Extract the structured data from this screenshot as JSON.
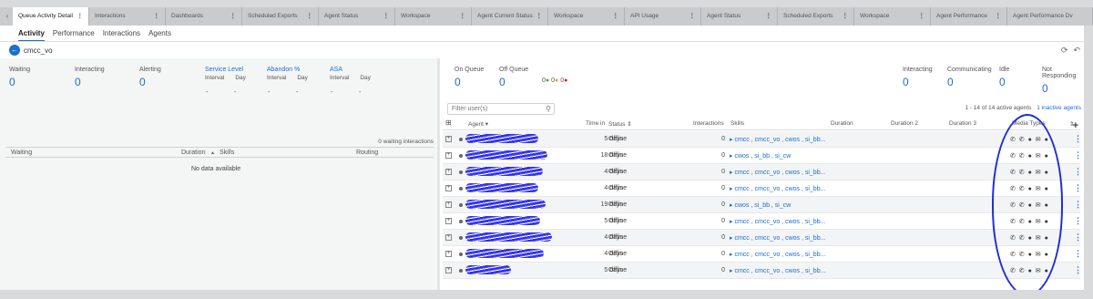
{
  "tabs": [
    {
      "label": "Queue Activity Detail",
      "active": true
    },
    {
      "label": "Interactions"
    },
    {
      "label": "Dashboards"
    },
    {
      "label": "Scheduled Exports"
    },
    {
      "label": "Agent Status"
    },
    {
      "label": "Workspace"
    },
    {
      "label": "Agent Current Status"
    },
    {
      "label": "Workspace"
    },
    {
      "label": "API Usage"
    },
    {
      "label": "Agent Status"
    },
    {
      "label": "Scheduled Exports"
    },
    {
      "label": "Workspace"
    },
    {
      "label": "Agent Performance"
    },
    {
      "label": "Agent Performance Dv"
    }
  ],
  "subtabs": [
    "Activity",
    "Performance",
    "Interactions",
    "Agents"
  ],
  "queue_name": "cmcc_vo",
  "left_stats": {
    "waiting": {
      "label": "Waiting",
      "value": "0"
    },
    "interacting": {
      "label": "Interacting",
      "value": "0"
    },
    "alerting": {
      "label": "Alerting",
      "value": "0"
    },
    "service_level": {
      "label": "Service Level",
      "interval": "Interval",
      "day": "Day",
      "dash": "-"
    },
    "abandon": {
      "label": "Abandon %",
      "interval": "Interval",
      "day": "Day",
      "dash": "-"
    },
    "asa": {
      "label": "ASA",
      "interval": "Interval",
      "day": "Day",
      "dash": "-"
    }
  },
  "waiting_interactions": "0 waiting interactions",
  "left_table": {
    "waiting": "Waiting",
    "duration": "Duration",
    "sort": "▲",
    "skills": "Skills",
    "routing": "Routing",
    "empty": "No data available"
  },
  "right_stats": {
    "on_queue": {
      "label": "On Queue",
      "value": "0"
    },
    "off_queue": {
      "label": "Off Queue",
      "value": "0"
    },
    "dots": [
      "0",
      "0",
      "0"
    ],
    "interacting": {
      "label": "Interacting",
      "value": "0"
    },
    "communicating": {
      "label": "Communicating",
      "value": "0"
    },
    "idle": {
      "label": "Idle",
      "value": "0"
    },
    "not_responding": {
      "label": "Not Responding",
      "value": "0"
    }
  },
  "filter_placeholder": "Filter user(s)",
  "agent_count": "1 - 14 of 14 active agents",
  "inactive_link": "1 inactive agents",
  "columns": {
    "agent": "Agent",
    "time_in": "Time in",
    "status": "Status",
    "interactions": "Interactions",
    "skills": "Skills",
    "duration": "Duration",
    "duration2": "Duration 2",
    "duration3": "Duration 3",
    "media": "Media Types"
  },
  "rows": [
    {
      "time_in": "5 days",
      "status": "Offline",
      "interactions": "0",
      "skills": "▸ cmcc , cmcc_vo , cwos , si_bb..."
    },
    {
      "time_in": "18 days",
      "status": "Offline",
      "interactions": "0",
      "skills": "▸ cwos , si_bb , si_cw"
    },
    {
      "time_in": "4 days",
      "status": "Offline",
      "interactions": "0",
      "skills": "▸ cmcc , cmcc_vo , cwos , si_bb..."
    },
    {
      "time_in": "4 days",
      "status": "Offline",
      "interactions": "0",
      "skills": "▸ cmcc , cmcc_vo , cwos , si_bb..."
    },
    {
      "time_in": "19 days",
      "status": "Offline",
      "interactions": "0",
      "skills": "▸ cwos , si_bb , si_cw"
    },
    {
      "time_in": "5 days",
      "status": "Offline",
      "interactions": "0",
      "skills": "▸ cmcc , cmcc_vo , cwos , si_bb..."
    },
    {
      "time_in": "4 days",
      "status": "Offline",
      "interactions": "0",
      "skills": "▸ cmcc , cmcc_vo , cwos , si_bb..."
    },
    {
      "time_in": "4 days",
      "status": "Offline",
      "interactions": "0",
      "skills": "▸ cmcc , cmcc_vo , cwos , si_bb..."
    },
    {
      "time_in": "5 days",
      "status": "Offline",
      "interactions": "0",
      "skills": "▸ cmcc , cmcc_vo , cwos , si_bb..."
    }
  ],
  "media_icons": "✆ ✆ ● ✉ ●",
  "colors": {
    "accent": "#1a6fcf",
    "green": "#3cb043",
    "orange": "#f0a020",
    "red": "#e02020",
    "annotation": "#1e2fd6"
  }
}
